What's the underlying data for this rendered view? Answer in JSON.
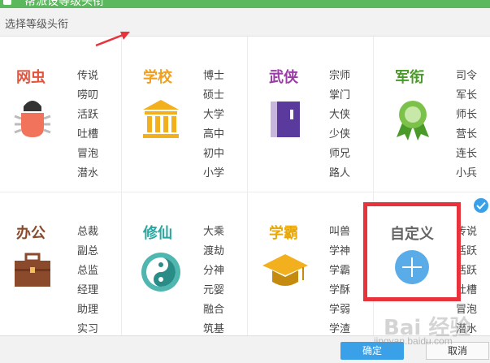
{
  "window": {
    "title": "帮派设等级头衔"
  },
  "subtitle": "选择等级头衔",
  "categories": [
    {
      "name": "网虫",
      "color": "#e2543e",
      "icon": "bug-icon",
      "items": [
        "传说",
        "唠叨",
        "活跃",
        "吐槽",
        "冒泡",
        "潜水"
      ]
    },
    {
      "name": "学校",
      "color": "#f0a01e",
      "icon": "school-building-icon",
      "items": [
        "博士",
        "硕士",
        "大学",
        "高中",
        "初中",
        "小学"
      ]
    },
    {
      "name": "武侠",
      "color": "#9b3da6",
      "icon": "book-icon",
      "items": [
        "宗师",
        "掌门",
        "大侠",
        "少侠",
        "师兄",
        "路人"
      ]
    },
    {
      "name": "军衔",
      "color": "#4a9a2a",
      "icon": "medal-icon",
      "items": [
        "司令",
        "军长",
        "师长",
        "营长",
        "连长",
        "小兵"
      ]
    },
    {
      "name": "办公",
      "color": "#8b4a2b",
      "icon": "briefcase-icon",
      "items": [
        "总裁",
        "副总",
        "总监",
        "经理",
        "助理",
        "实习"
      ]
    },
    {
      "name": "修仙",
      "color": "#2aa6a0",
      "icon": "yin-yang-icon",
      "items": [
        "大乘",
        "渡劫",
        "分神",
        "元婴",
        "融合",
        "筑基"
      ]
    },
    {
      "name": "学霸",
      "color": "#e8a80c",
      "icon": "graduation-cap-icon",
      "items": [
        "叫兽",
        "学神",
        "学霸",
        "学酥",
        "学弱",
        "学渣"
      ]
    }
  ],
  "custom": {
    "label": "自定义",
    "icon": "plus-icon",
    "items": [
      "传说",
      "活跃",
      "活跃",
      "吐槽",
      "冒泡",
      "潜水"
    ]
  },
  "buttons": {
    "ok": "确定",
    "cancel": "取消"
  },
  "watermark": {
    "text": "Bai 经验",
    "sub": "jingyan.baidu.com"
  }
}
